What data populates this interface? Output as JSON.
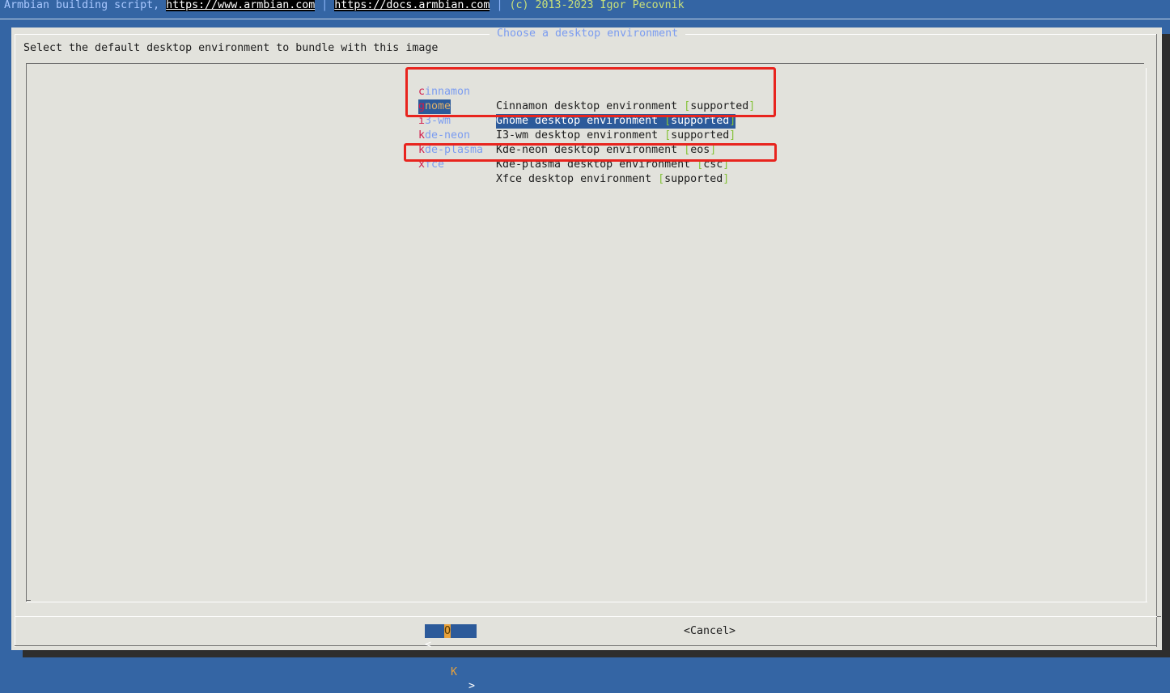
{
  "backtitle": {
    "prefix": "Armbian building script, ",
    "link1": "https://www.armbian.com",
    "sep1": " | ",
    "link2": "https://docs.armbian.com",
    "sep2": " | ",
    "copyright": "(c) 2013-2023 Igor Pecovnik"
  },
  "dialog": {
    "title": " Choose a desktop environment ",
    "prompt": "Select the default desktop environment to bundle with this image",
    "items": [
      {
        "tag_first": "c",
        "tag_rest": "innamon",
        "desc": "Cinnamon desktop environment ",
        "status": "supported"
      },
      {
        "tag_first": "g",
        "tag_rest": "nome",
        "desc": "Gnome desktop environment ",
        "status": "supported"
      },
      {
        "tag_first": "i",
        "tag_rest": "3-wm",
        "desc": "I3-wm desktop environment ",
        "status": "supported"
      },
      {
        "tag_first": "k",
        "tag_rest": "de-neon",
        "desc": "Kde-neon desktop environment ",
        "status": "eos"
      },
      {
        "tag_first": "k",
        "tag_rest": "de-plasma",
        "desc": "Kde-plasma desktop environment ",
        "status": "csc"
      },
      {
        "tag_first": "x",
        "tag_rest": "fce",
        "desc": "Xfce desktop environment ",
        "status": "supported"
      }
    ],
    "selected_index": 1,
    "buttons": {
      "ok_left": "<",
      "ok_hot": "O",
      "ok_rest": "K",
      "ok_right": ">",
      "cancel": "<Cancel>"
    }
  },
  "colors": {
    "background": "#3465a4",
    "dialog": "#e2e2dc",
    "selection": "#2c5a9a",
    "hotkey": "#d11b4a",
    "tag": "#7b9cf0",
    "bracket": "#86c23a",
    "annotation": "#e8241e"
  }
}
